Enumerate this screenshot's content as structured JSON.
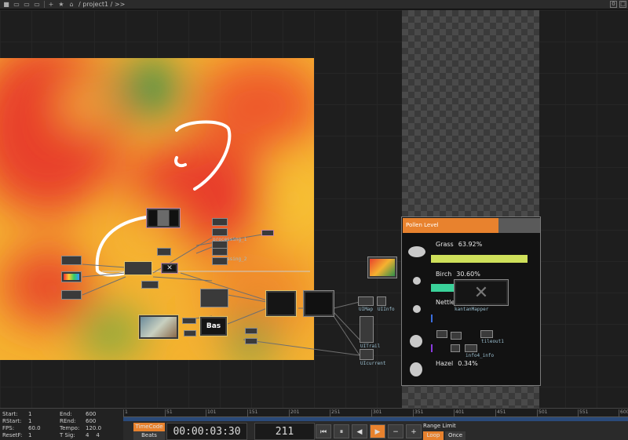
{
  "topbar": {
    "path": "/ project1 / >>",
    "right_count": "0"
  },
  "panel": {
    "title": "Pollen Level",
    "items": [
      {
        "name": "Grass",
        "pct": "63.92%",
        "fraction": 0.6392,
        "color": "#cfe05a"
      },
      {
        "name": "Birch",
        "pct": "30.60%",
        "fraction": 0.306,
        "color": "#3ad29a"
      },
      {
        "name": "Nettle",
        "pct": "",
        "fraction": 0.0,
        "color": "#3a6ee0"
      },
      {
        "name": "Hazel",
        "pct": "0.34%",
        "fraction": 0.0034,
        "color": "#8a3ae0"
      }
    ]
  },
  "nodes": {
    "processing_1": "processing_1",
    "processing_2": "processing_2",
    "uimap": "UIMap",
    "uiinfo": "UIInfo",
    "uitrail": "UITrail",
    "uicurrent": "UIcurrent",
    "kantanmapper": "kantanMapper",
    "bas": "Bas",
    "tileout": "tileout1",
    "info4": "info4_info"
  },
  "timeline": {
    "start_label": "Start:",
    "start": "1",
    "end_label": "End:",
    "end": "600",
    "rstart_label": "RStart:",
    "rstart": "1",
    "rend_label": "REnd:",
    "rend": "600",
    "fps_label": "FPS:",
    "fps": "60.0",
    "tempo_label": "Tempo:",
    "tempo": "120.0",
    "resetf_label": "ResetF:",
    "resetf": "1",
    "tsig_label": "T Sig:",
    "tsig_a": "4",
    "tsig_b": "4",
    "ruler": [
      "1",
      "51",
      "101",
      "151",
      "201",
      "251",
      "301",
      "351",
      "401",
      "451",
      "501",
      "551",
      "600"
    ],
    "timecode_btn": "TimeCode",
    "beats_btn": "Beats",
    "timecode": "00:00:03:30",
    "frame": "211",
    "range_limit": "Range Limit",
    "loop": "Loop",
    "once": "Once"
  }
}
